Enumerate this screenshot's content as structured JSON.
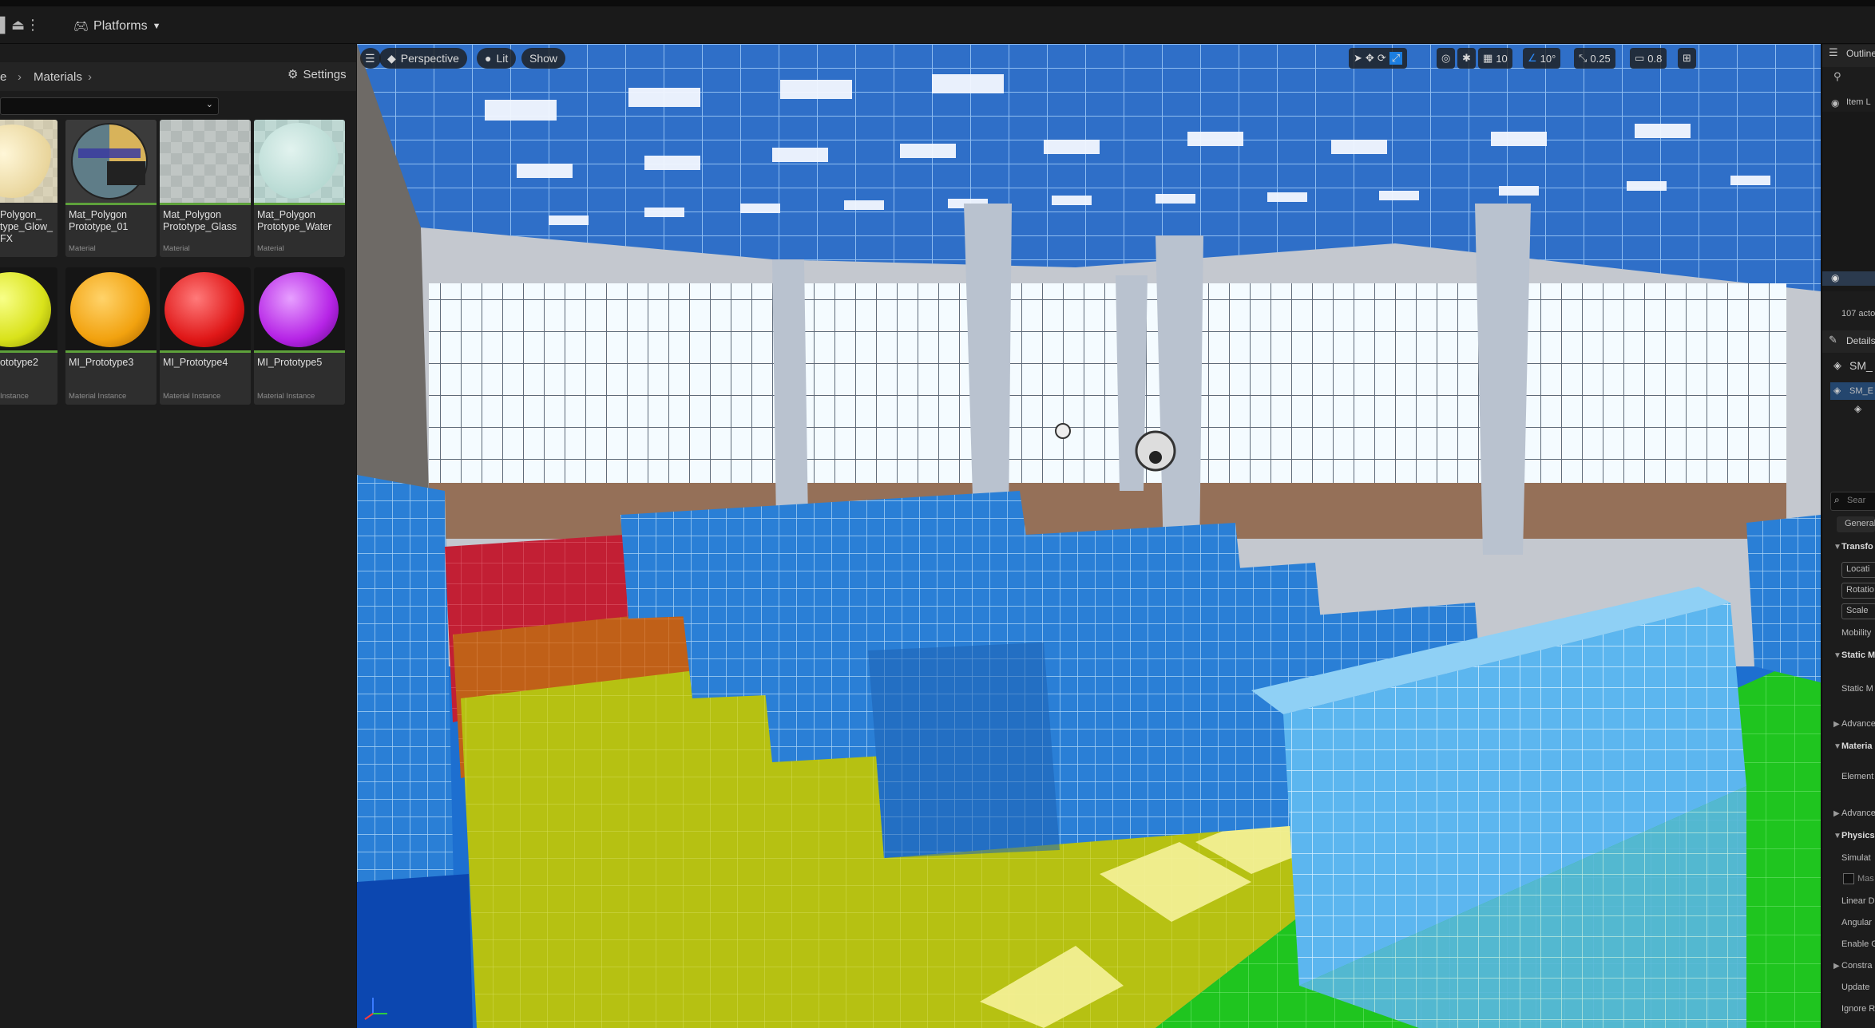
{
  "toolbar": {
    "platforms_label": "Platforms"
  },
  "content_browser": {
    "breadcrumb": [
      "e",
      "Materials"
    ],
    "settings_label": "Settings",
    "tiles": [
      {
        "name": "Polygon_\ntype_Glow_\nFX",
        "type": ""
      },
      {
        "name": "Mat_Polygon\nPrototype_01",
        "type": "Material"
      },
      {
        "name": "Mat_Polygon\nPrototype_Glass",
        "type": "Material"
      },
      {
        "name": "Mat_Polygon\nPrototype_Water",
        "type": "Material"
      },
      {
        "name": "ototype2",
        "type": "Instance"
      },
      {
        "name": "MI_Prototype3",
        "type": "Material Instance"
      },
      {
        "name": "MI_Prototype4",
        "type": "Material Instance"
      },
      {
        "name": "MI_Prototype5",
        "type": "Material Instance"
      }
    ]
  },
  "viewport": {
    "perspective_label": "Perspective",
    "lit_label": "Lit",
    "show_label": "Show",
    "grid_snap": "10",
    "rotation_snap": "10°",
    "scale_snap": "0.25",
    "camera_speed": "0.8"
  },
  "outliner": {
    "title": "Outline",
    "item_label_header": "Item L",
    "actor_count": "107 acto"
  },
  "details": {
    "title": "Details",
    "actor_name": "SM_",
    "component_name": "SM_E",
    "search_placeholder": "Sear",
    "general_tab": "General",
    "transform_section": "Transfo",
    "location_label": "Locati",
    "rotation_label": "Rotatio",
    "scale_label": "Scale",
    "mobility_label": "Mobility",
    "static_mesh_section": "Static M",
    "static_mesh_label": "Static M",
    "advanced_1": "Advance",
    "materials_section": "Materia",
    "element_label": "Element",
    "advanced_2": "Advance",
    "physics_section": "Physics",
    "simulate_label": "Simulat",
    "mass_label": "Mas",
    "linear_label": "Linear D",
    "angular_label": "Angular",
    "enable_label": "Enable G",
    "constraints_label": "Constra",
    "update_label": "Update",
    "ignore_label": "Ignore R"
  }
}
